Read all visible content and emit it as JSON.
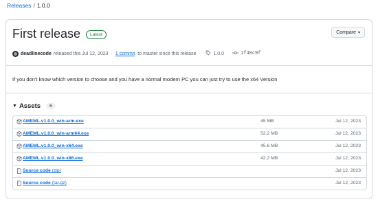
{
  "breadcrumb": {
    "parent": "Releases",
    "separator": "/",
    "current": "1.0.0"
  },
  "release": {
    "title": "First release",
    "badge": "Latest",
    "compare_label": "Compare",
    "author": "deadlinecode",
    "released_text": "released this Jul 12, 2023",
    "commit_link": "1 commit",
    "commit_text": "to master since this release",
    "tag": "1.0.0",
    "commit_hash": "1f40c9f",
    "description": "If you don't know which version to choose and you have a normal modern PC you can just try to use the x64 Version"
  },
  "assets": {
    "label": "Assets",
    "count": "6",
    "items": [
      {
        "icon": "package-icon",
        "name": "AMEML.v1.0.0_win-arm.exe",
        "suffix": "",
        "size": "45 MB",
        "date": "Jul 12, 2023"
      },
      {
        "icon": "package-icon",
        "name": "AMEML.v1.0.0_win-arm64.exe",
        "suffix": "",
        "size": "52.2 MB",
        "date": "Jul 12, 2023"
      },
      {
        "icon": "package-icon",
        "name": "AMEML.v1.0.0_win-x64.exe",
        "suffix": "",
        "size": "45.6 MB",
        "date": "Jul 12, 2023"
      },
      {
        "icon": "package-icon",
        "name": "AMEML.v1.0.0_win-x86.exe",
        "suffix": "",
        "size": "42.2 MB",
        "date": "Jul 12, 2023"
      },
      {
        "icon": "file-zip-icon",
        "name": "Source code",
        "suffix": "(zip)",
        "size": "",
        "date": "Jul 12, 2023"
      },
      {
        "icon": "file-zip-icon",
        "name": "Source code",
        "suffix": "(tar.gz)",
        "size": "",
        "date": "Jul 12, 2023"
      }
    ]
  }
}
